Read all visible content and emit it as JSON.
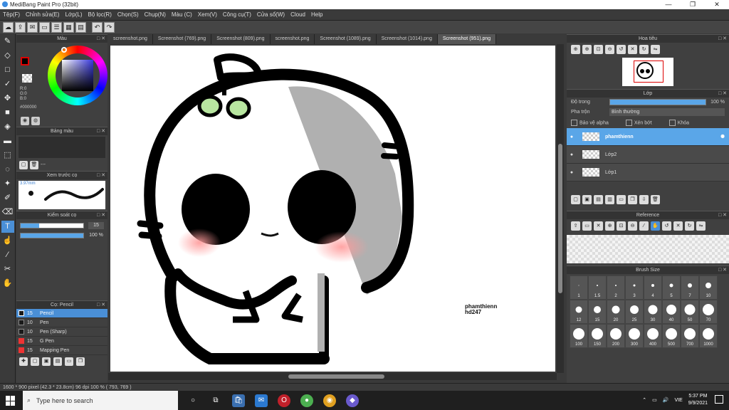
{
  "window": {
    "title": "MediBang Paint Pro (32bit)",
    "minimize": "—",
    "maximize": "❐",
    "close": "✕"
  },
  "menu": [
    "Tệp(F)",
    "Chỉnh sửa(E)",
    "Lớp(L)",
    "Bộ lọc(R)",
    "Chọn(S)",
    "Chụp(N)",
    "Màu (C)",
    "Xem(V)",
    "Công cụ(T)",
    "Cửa sổ(W)",
    "Cloud",
    "Help"
  ],
  "left": {
    "color_panel": "Màu",
    "rgb": "R:0\nG:0\nB:0",
    "hex": "#000000",
    "palette_panel": "Bảng màu",
    "palette_dash": "---",
    "preview_panel": "Xem trước cọ",
    "preview_size": "3.97mm",
    "brush_control_panel": "Kiểm soát cọ",
    "brush_size_value": "15",
    "opacity_value": "100 %",
    "brush_list_panel": "Cọ: Pencil",
    "brushes": [
      {
        "size": "15",
        "name": "Pencil",
        "color": "#1a1a1a"
      },
      {
        "size": "10",
        "name": "Pen",
        "color": "#1a1a1a"
      },
      {
        "size": "10",
        "name": "Pen (Sharp)",
        "color": "#1a1a1a"
      },
      {
        "size": "15",
        "name": "G Pen",
        "color": "#e33"
      },
      {
        "size": "15",
        "name": "Mapping Pen",
        "color": "#e33"
      }
    ]
  },
  "tabs": [
    "screenshot.png",
    "Screenshot (769).png",
    "Screenshot (809).png",
    "screenshot.png",
    "Screenshot (1089).png",
    "Screenshot (1014).png",
    "Screenshot (951).png"
  ],
  "canvas": {
    "signature_line1": "phamthienn",
    "signature_line2": "hd247"
  },
  "status": "1600 * 900 pixel  (42.3 * 23.8cm)  96 dpi  100 %  ( 793, 769 )",
  "right": {
    "navigator_panel": "Hoa tiêu",
    "layer_panel": "Lớp",
    "opacity_label": "Độ trong",
    "opacity_value": "100 %",
    "blend_label": "Pha trộn",
    "blend_value": "Bình thường",
    "protect_alpha": "Bảo vệ alpha",
    "clipping": "Xén bớt",
    "lock": "Khóa",
    "layers": [
      "phamthienn",
      "Lớp2",
      "Lớp1"
    ],
    "reference_panel": "Reference",
    "brush_size_panel": "Brush Size",
    "sizes": [
      "1",
      "1.5",
      "2",
      "3",
      "4",
      "5",
      "7",
      "10",
      "12",
      "15",
      "20",
      "25",
      "30",
      "40",
      "50",
      "70",
      "100",
      "150",
      "200",
      "300",
      "400",
      "500",
      "700",
      "1000"
    ]
  },
  "taskbar": {
    "search_placeholder": "Type here to search",
    "lang": "VIE",
    "time": "5:37 PM",
    "date": "9/9/2021"
  }
}
